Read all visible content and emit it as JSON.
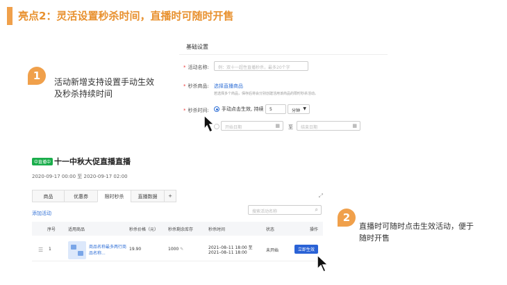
{
  "header": {
    "title": "亮点2：灵活设置秒杀时间，直播时可随时开售"
  },
  "notes": [
    {
      "badge": "1",
      "line1": "活动新增支持设置手动生效",
      "line2": "及秒杀持续时间"
    },
    {
      "badge": "2",
      "line1": "直播时可随时点击生效活动，便于",
      "line2": "随时开售"
    }
  ],
  "form": {
    "title": "基础设置",
    "name_label": "活动名称:",
    "name_placeholder": "例：双十一超性直播秒杀，最多20个字",
    "goods_label": "秒杀商品:",
    "goods_link": "选择直播商品",
    "goods_hint": "若选择多个商品，保存后将会分别创建活用该商品的限时秒杀活动。",
    "time_label": "秒杀时间:",
    "manual_option": "手动点击生效, 持续",
    "duration_value": "5",
    "duration_unit": "分钟",
    "start_placeholder": "开始日期",
    "to_label": "至",
    "end_placeholder": "结束日期"
  },
  "live": {
    "tag": "中直播中",
    "title": "十一中秋大促直播直播",
    "time_range": "2020-09-17 00:00 至 2020-09-17 02:00",
    "tabs": [
      "商品",
      "优惠券",
      "限时秒杀",
      "直播数据",
      "+"
    ],
    "active_tab": 2,
    "add_activity": "添加活动",
    "search_placeholder": "搜索活动名称",
    "columns": [
      "序号",
      "适用商品",
      "秒杀价格（元）",
      "秒杀剩余库存",
      "秒杀时间",
      "状态",
      "操作"
    ],
    "rows": [
      {
        "index": "1",
        "goods_name": "商品名称最多两行商品名称...",
        "price": "19.90",
        "stock": "1000",
        "time_start": "2021–08–11 18:00 至",
        "time_end": "2021–08–11 18:00",
        "status": "未开始",
        "action": "立即生效"
      }
    ]
  },
  "colors": {
    "accent": "#f0a04b",
    "link": "#2f6fd6",
    "live_green": "#1aad4b",
    "button_blue": "#2a62d6"
  }
}
